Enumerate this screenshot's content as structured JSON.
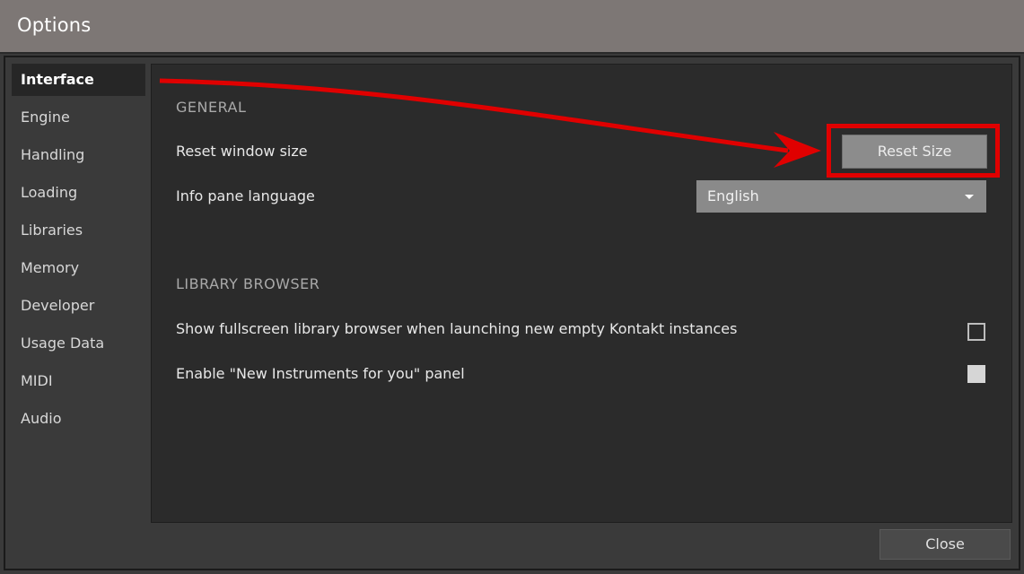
{
  "window": {
    "title": "Options"
  },
  "sidebar": {
    "items": [
      {
        "label": "Interface",
        "active": true
      },
      {
        "label": "Engine"
      },
      {
        "label": "Handling"
      },
      {
        "label": "Loading"
      },
      {
        "label": "Libraries"
      },
      {
        "label": "Memory"
      },
      {
        "label": "Developer"
      },
      {
        "label": "Usage Data"
      },
      {
        "label": "MIDI"
      },
      {
        "label": "Audio"
      }
    ]
  },
  "general": {
    "header": "GENERAL",
    "reset_label": "Reset window size",
    "reset_button": "Reset Size",
    "language_label": "Info pane language",
    "language_value": "English"
  },
  "library_browser": {
    "header": "LIBRARY BROWSER",
    "fullscreen_label": "Show fullscreen library browser when launching new empty Kontakt instances",
    "fullscreen_checked": false,
    "new_instruments_label": "Enable \"New Instruments for you\" panel",
    "new_instruments_checked": true
  },
  "footer": {
    "close_button": "Close"
  },
  "annotation": {
    "color": "#e00000"
  },
  "colors": {
    "titlebar": "#7d7775",
    "panel": "#2b2b2b",
    "window": "#3a3a3a",
    "button": "#8c8c8c"
  }
}
